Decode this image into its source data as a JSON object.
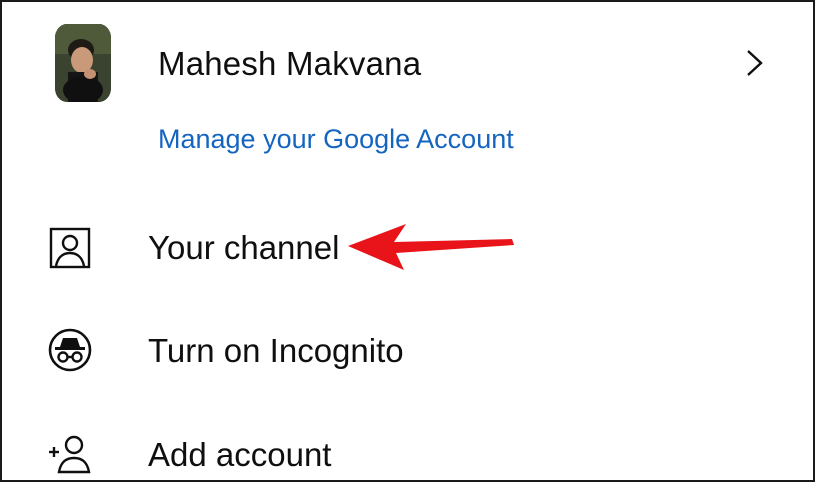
{
  "account": {
    "name": "Mahesh Makvana",
    "manage_link": "Manage your Google Account"
  },
  "menu": {
    "items": [
      {
        "label": "Your channel",
        "icon": "person-box-icon"
      },
      {
        "label": "Turn on Incognito",
        "icon": "incognito-icon"
      },
      {
        "label": "Add account",
        "icon": "add-person-icon"
      }
    ]
  },
  "colors": {
    "link": "#1565c0",
    "text": "#0f0f0f",
    "annotation_arrow": "#e8141a",
    "frame_border": "#1a1a1a"
  }
}
